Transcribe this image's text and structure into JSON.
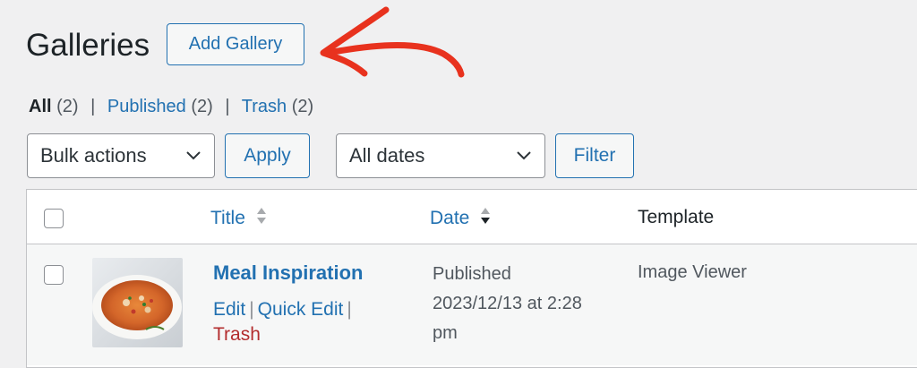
{
  "header": {
    "title": "Galleries",
    "add_button": "Add Gallery"
  },
  "views": [
    {
      "label": "All",
      "count": "(2)",
      "current": true
    },
    {
      "label": "Published",
      "count": "(2)"
    },
    {
      "label": "Trash",
      "count": "(2)"
    }
  ],
  "views_separator": "|",
  "toolbar": {
    "bulk_actions": "Bulk actions",
    "apply": "Apply",
    "dates": "All dates",
    "filter": "Filter"
  },
  "table": {
    "columns": {
      "title": "Title",
      "date": "Date",
      "template": "Template"
    },
    "rows": [
      {
        "title": "Meal Inspiration",
        "actions": {
          "edit": "Edit",
          "quick_edit": "Quick Edit",
          "trash": "Trash"
        },
        "date_status": "Published",
        "date_value": "2023/12/13 at 2:28",
        "date_value_2": "pm",
        "template": "Image Viewer",
        "thumbnail_alt": "soup-thumbnail"
      }
    ]
  },
  "colors": {
    "link": "#2271b1",
    "trash": "#b32d2e",
    "arrow": "#e8321e",
    "background": "#f0f0f1"
  }
}
